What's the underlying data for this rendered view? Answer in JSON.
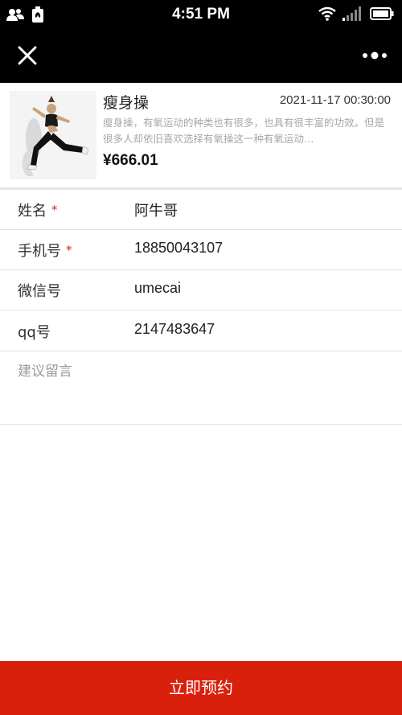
{
  "status_bar": {
    "time": "4:51 PM"
  },
  "product": {
    "title": "瘦身操",
    "datetime": "2021-11-17 00:30:00",
    "description": "瘦身操，有氧运动的种类也有很多，也具有很丰富的功效。但是很多人却依旧喜欢选择有氧操这一种有氧运动…",
    "price": "¥666.01"
  },
  "form": {
    "fields": [
      {
        "label": "姓名",
        "required_mark": "*",
        "value": "阿牛哥"
      },
      {
        "label": "手机号",
        "required_mark": "*",
        "value": "18850043107"
      },
      {
        "label": "微信号",
        "required_mark": "",
        "value": "umecai"
      },
      {
        "label": "qq号",
        "required_mark": "",
        "value": "2147483647"
      }
    ],
    "remark_placeholder": "建议留言"
  },
  "submit_label": "立即预约",
  "colors": {
    "accent": "#d9200c",
    "required": "#e0201c",
    "header_bg": "#000000"
  }
}
